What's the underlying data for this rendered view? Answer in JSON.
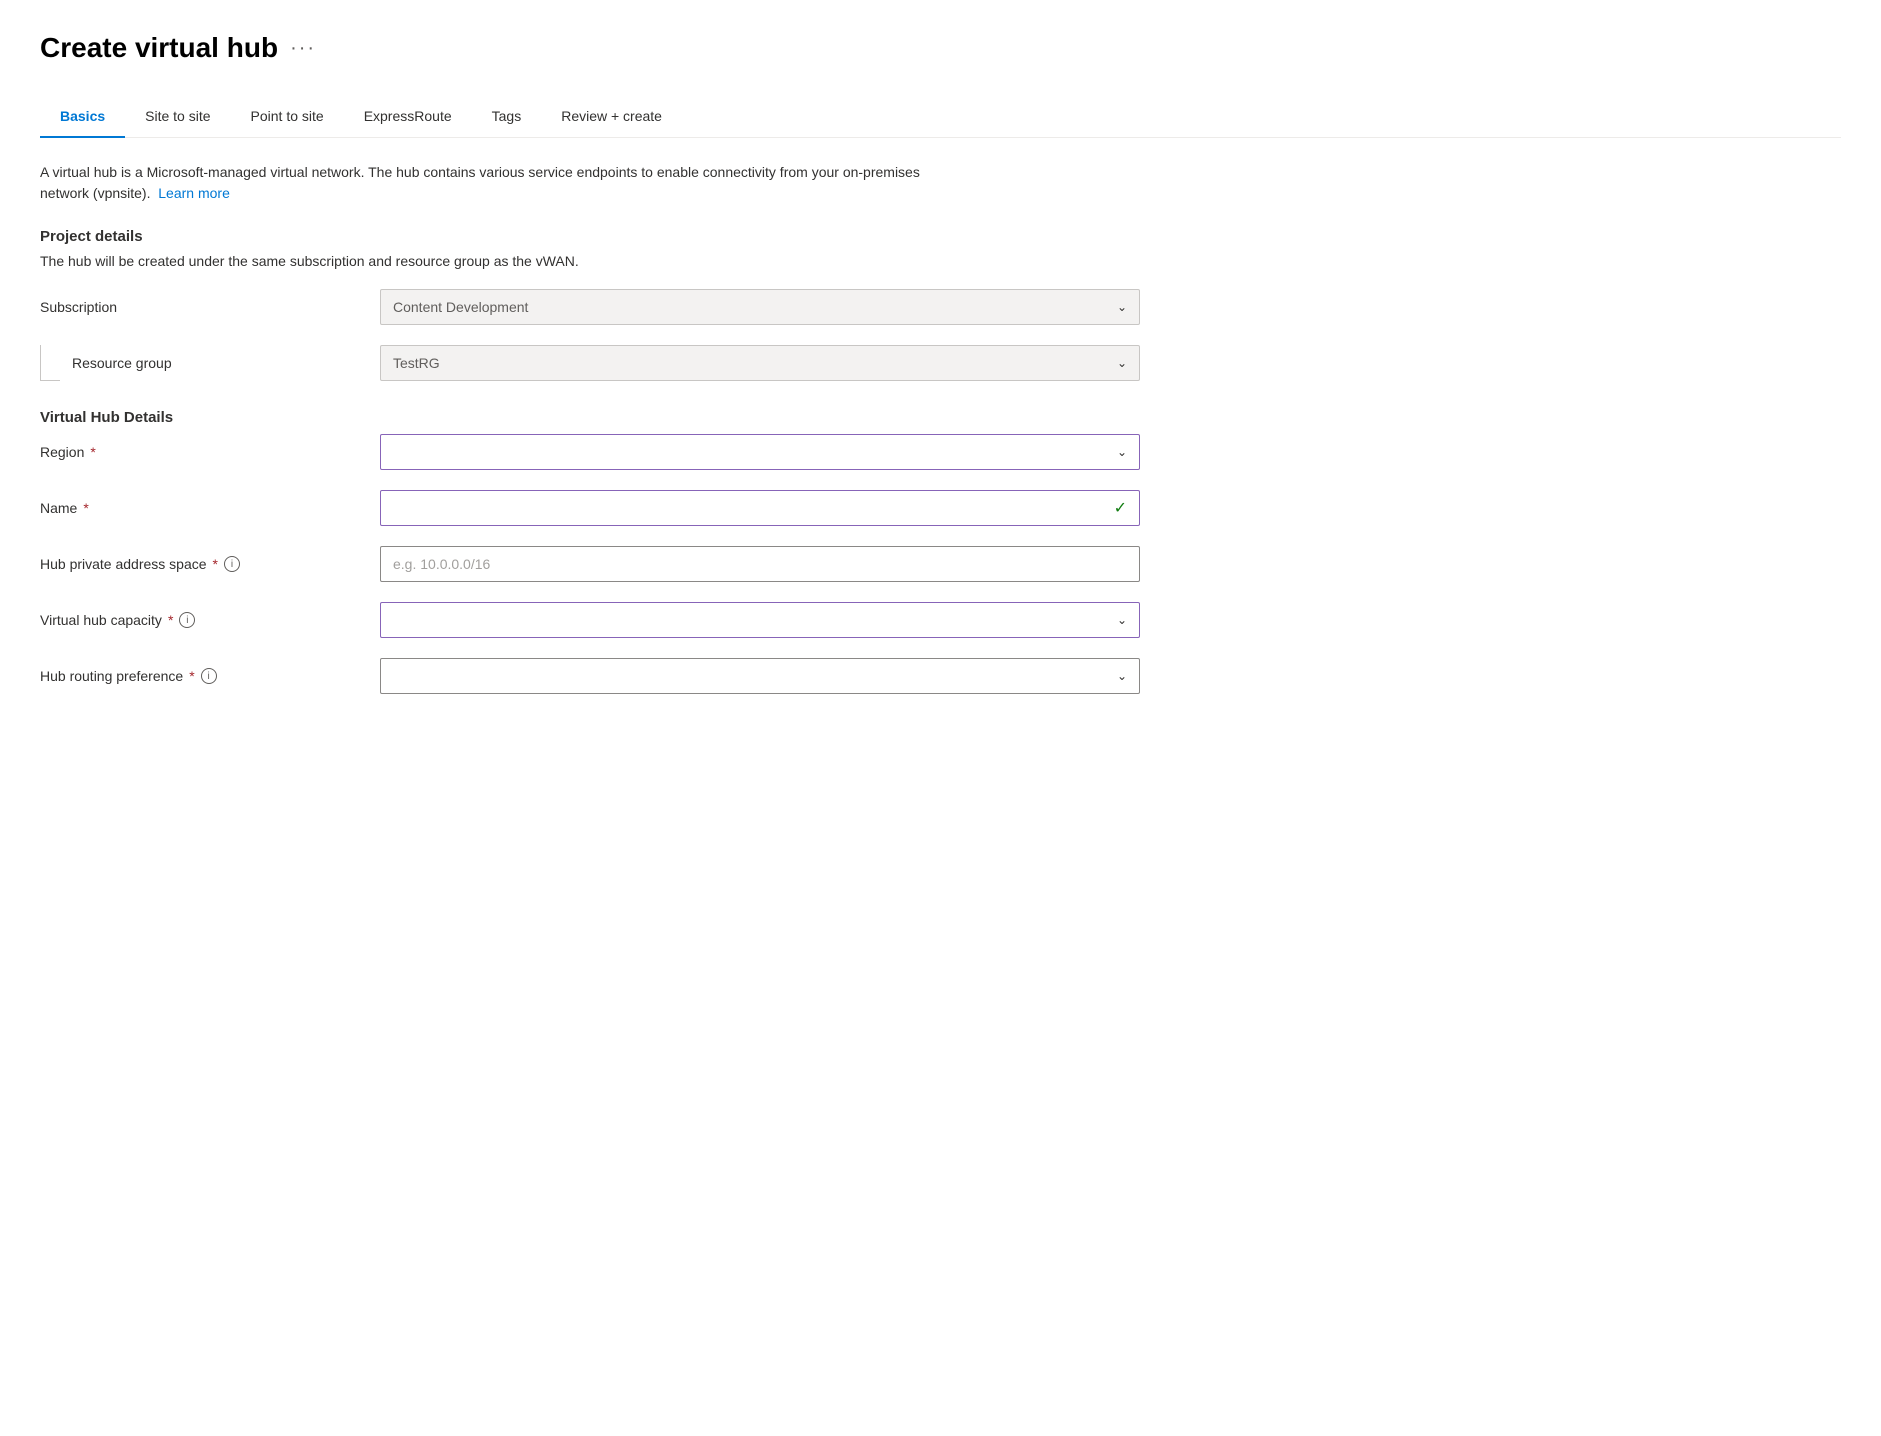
{
  "page": {
    "title": "Create virtual hub",
    "more_options_label": "···"
  },
  "tabs": [
    {
      "id": "basics",
      "label": "Basics",
      "active": true
    },
    {
      "id": "site-to-site",
      "label": "Site to site",
      "active": false
    },
    {
      "id": "point-to-site",
      "label": "Point to site",
      "active": false
    },
    {
      "id": "expressroute",
      "label": "ExpressRoute",
      "active": false
    },
    {
      "id": "tags",
      "label": "Tags",
      "active": false
    },
    {
      "id": "review-create",
      "label": "Review + create",
      "active": false
    }
  ],
  "description": {
    "text": "A virtual hub is a Microsoft-managed virtual network. The hub contains various service endpoints to enable connectivity from your on-premises network (vpnsite).",
    "learn_more": "Learn more"
  },
  "project_details": {
    "header": "Project details",
    "desc": "The hub will be created under the same subscription and resource group as the vWAN.",
    "subscription_label": "Subscription",
    "subscription_value": "Content Development",
    "resource_group_label": "Resource group",
    "resource_group_value": "TestRG"
  },
  "virtual_hub_details": {
    "header": "Virtual Hub Details",
    "fields": [
      {
        "id": "region",
        "label": "Region",
        "required": true,
        "info": false,
        "type": "dropdown-active",
        "value": "",
        "placeholder": ""
      },
      {
        "id": "name",
        "label": "Name",
        "required": true,
        "info": false,
        "type": "dropdown-active-check",
        "value": "",
        "placeholder": ""
      },
      {
        "id": "hub-private-address-space",
        "label": "Hub private address space",
        "required": true,
        "info": true,
        "type": "text",
        "value": "",
        "placeholder": "e.g. 10.0.0.0/16"
      },
      {
        "id": "virtual-hub-capacity",
        "label": "Virtual hub capacity",
        "required": true,
        "info": true,
        "type": "dropdown-active",
        "value": "",
        "placeholder": ""
      },
      {
        "id": "hub-routing-preference",
        "label": "Hub routing preference",
        "required": true,
        "info": true,
        "type": "dropdown-normal",
        "value": "",
        "placeholder": ""
      }
    ]
  },
  "icons": {
    "chevron_down": "⌄",
    "checkmark": "✓",
    "info": "i"
  }
}
